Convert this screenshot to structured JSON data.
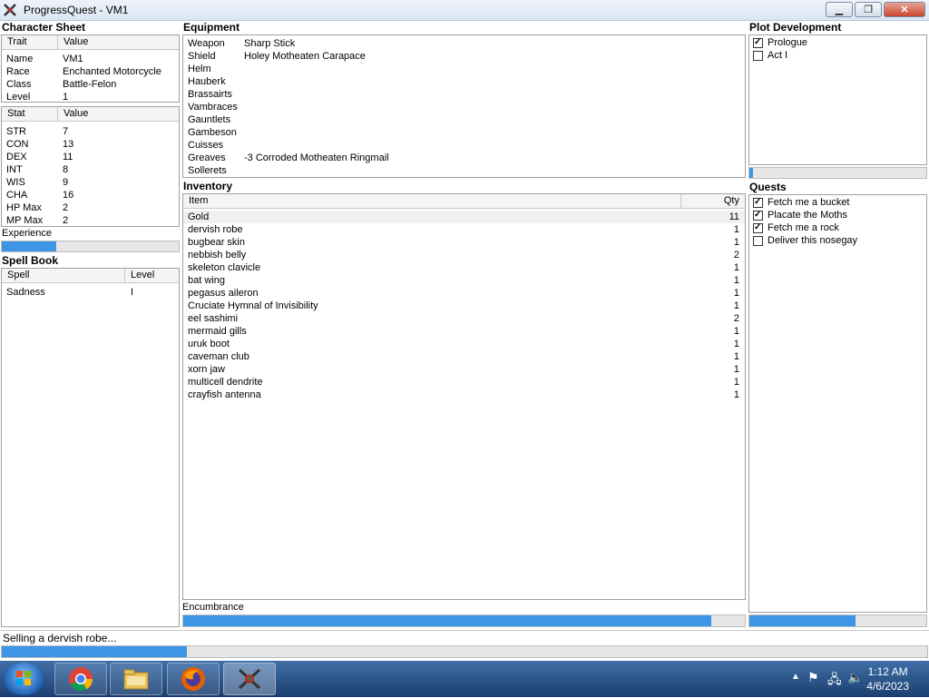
{
  "window": {
    "title": "ProgressQuest - VM1",
    "min_icon": "minimize-icon",
    "max_icon": "maximize-icon",
    "close_icon": "close-icon"
  },
  "character_sheet": {
    "heading": "Character Sheet",
    "trait_header": "Trait",
    "value_header": "Value",
    "traits": [
      {
        "label": "Name",
        "value": "VM1"
      },
      {
        "label": "Race",
        "value": "Enchanted Motorcycle"
      },
      {
        "label": "Class",
        "value": "Battle-Felon"
      },
      {
        "label": "Level",
        "value": "1"
      }
    ],
    "stat_header": "Stat",
    "stat_value_header": "Value",
    "stats": [
      {
        "label": "STR",
        "value": "7"
      },
      {
        "label": "CON",
        "value": "13"
      },
      {
        "label": "DEX",
        "value": "11"
      },
      {
        "label": "INT",
        "value": "8"
      },
      {
        "label": "WIS",
        "value": "9"
      },
      {
        "label": "CHA",
        "value": "16"
      },
      {
        "label": "HP Max",
        "value": "2"
      },
      {
        "label": "MP Max",
        "value": "2"
      }
    ],
    "experience_label": "Experience",
    "experience_progress": 0.31
  },
  "spell_book": {
    "heading": "Spell Book",
    "spell_header": "Spell",
    "level_header": "Level",
    "spells": [
      {
        "name": "Sadness",
        "level": "I"
      }
    ]
  },
  "equipment": {
    "heading": "Equipment",
    "slots": [
      {
        "slot": "Weapon",
        "item": "Sharp Stick"
      },
      {
        "slot": "Shield",
        "item": "Holey Motheaten Carapace"
      },
      {
        "slot": "Helm",
        "item": ""
      },
      {
        "slot": "Hauberk",
        "item": ""
      },
      {
        "slot": "Brassairts",
        "item": ""
      },
      {
        "slot": "Vambraces",
        "item": ""
      },
      {
        "slot": "Gauntlets",
        "item": ""
      },
      {
        "slot": "Gambeson",
        "item": ""
      },
      {
        "slot": "Cuisses",
        "item": ""
      },
      {
        "slot": "Greaves",
        "item": "-3 Corroded Motheaten Ringmail"
      },
      {
        "slot": "Sollerets",
        "item": ""
      }
    ]
  },
  "inventory": {
    "heading": "Inventory",
    "item_header": "Item",
    "qty_header": "Qty",
    "items": [
      {
        "name": "Gold",
        "qty": "11"
      },
      {
        "name": "dervish robe",
        "qty": "1"
      },
      {
        "name": "bugbear skin",
        "qty": "1"
      },
      {
        "name": "nebbish belly",
        "qty": "2"
      },
      {
        "name": "skeleton clavicle",
        "qty": "1"
      },
      {
        "name": "bat wing",
        "qty": "1"
      },
      {
        "name": "pegasus aileron",
        "qty": "1"
      },
      {
        "name": "Cruciate Hymnal of Invisibility",
        "qty": "1"
      },
      {
        "name": "eel sashimi",
        "qty": "2"
      },
      {
        "name": "mermaid gills",
        "qty": "1"
      },
      {
        "name": "uruk boot",
        "qty": "1"
      },
      {
        "name": "caveman club",
        "qty": "1"
      },
      {
        "name": "xorn jaw",
        "qty": "1"
      },
      {
        "name": "multicell dendrite",
        "qty": "1"
      },
      {
        "name": "crayfish antenna",
        "qty": "1"
      }
    ],
    "encumbrance_label": "Encumbrance",
    "encumbrance_progress": 0.94
  },
  "plot": {
    "heading": "Plot Development",
    "acts": [
      {
        "label": "Prologue",
        "checked": true
      },
      {
        "label": "Act I",
        "checked": false
      }
    ],
    "progress": 0.02
  },
  "quests": {
    "heading": "Quests",
    "items": [
      {
        "label": "Fetch me a bucket",
        "checked": true
      },
      {
        "label": "Placate the Moths",
        "checked": true
      },
      {
        "label": "Fetch me a rock",
        "checked": true
      },
      {
        "label": "Deliver this nosegay",
        "checked": false
      }
    ],
    "progress": 0.6
  },
  "status": {
    "text": "Selling a dervish robe...",
    "progress": 0.2
  },
  "taskbar": {
    "apps": [
      "chrome-icon",
      "file-explorer-icon",
      "firefox-icon",
      "progressquest-icon"
    ],
    "time": "1:12 AM",
    "date": "4/6/2023"
  },
  "colors": {
    "progress": "#3d95e6"
  }
}
